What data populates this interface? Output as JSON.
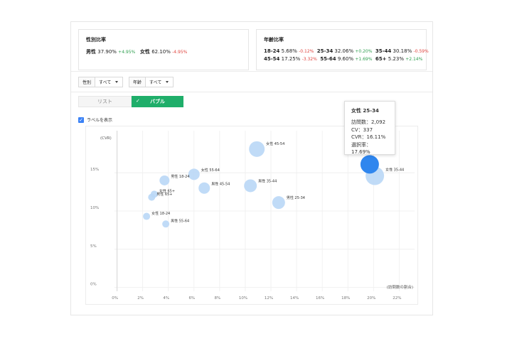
{
  "gender": {
    "title": "性別比率",
    "male_label": "男性",
    "male_value": "37.90%",
    "male_delta": "+4.95%",
    "female_label": "女性",
    "female_value": "62.10%",
    "female_delta": "-4.95%"
  },
  "age": {
    "title": "年齢比率",
    "items": [
      {
        "label": "18-24",
        "value": "5.68%",
        "delta": "-0.12%",
        "dir": "neg"
      },
      {
        "label": "25-34",
        "value": "32.06%",
        "delta": "+0.20%",
        "dir": "pos"
      },
      {
        "label": "35-44",
        "value": "30.18%",
        "delta": "-0.59%",
        "dir": "neg"
      },
      {
        "label": "45-54",
        "value": "17.25%",
        "delta": "-3.32%",
        "dir": "neg"
      },
      {
        "label": "55-64",
        "value": "9.60%",
        "delta": "+1.69%",
        "dir": "pos"
      },
      {
        "label": "65+",
        "value": "5.23%",
        "delta": "+2.14%",
        "dir": "pos"
      }
    ]
  },
  "filters": {
    "gender_label": "性別",
    "gender_value": "すべて",
    "age_label": "年齢",
    "age_value": "すべて"
  },
  "view_toggle": {
    "list_label": "リスト",
    "bubble_label": "バブル",
    "check_glyph": "✓"
  },
  "show_labels": {
    "label": "ラベルを表示",
    "checked": true
  },
  "tooltip": {
    "title": "女性 25-34",
    "visits": "訪問数：2,092",
    "cv": "CV：337",
    "cvr": "CVR：16.11%",
    "share": "選択率：17.69%"
  },
  "chart_data": {
    "type": "scatter",
    "title": "",
    "xlabel": "(訪問数の割合)",
    "ylabel": "(CVR)",
    "x_ticks": [
      "0%",
      "2%",
      "4%",
      "6%",
      "8%",
      "10%",
      "12%",
      "14%",
      "16%",
      "18%",
      "20%",
      "22%"
    ],
    "y_ticks": [
      "0%",
      "5%",
      "10%",
      "15%"
    ],
    "xlim": [
      -0.2,
      23.2
    ],
    "ylim": [
      -0.5,
      20.5
    ],
    "colors": {
      "bubble": "#b9d7f6",
      "highlight": "#2f86ee",
      "grid": "#eeeeee"
    },
    "points": [
      {
        "label": "女性 45-54",
        "x": 10.9,
        "y": 18.1,
        "size": 11
      },
      {
        "label": "女性 25-34",
        "x": 19.7,
        "y": 16.1,
        "size": 13,
        "highlight": true
      },
      {
        "label": "女性 35-44",
        "x": 20.1,
        "y": 14.6,
        "size": 13
      },
      {
        "label": "女性 55-64",
        "x": 6.0,
        "y": 14.8,
        "size": 8
      },
      {
        "label": "男性 18-24",
        "x": 3.7,
        "y": 14.0,
        "size": 7
      },
      {
        "label": "男性 45-54",
        "x": 6.8,
        "y": 13.0,
        "size": 8
      },
      {
        "label": "男性 35-44",
        "x": 10.4,
        "y": 13.3,
        "size": 9
      },
      {
        "label": "男性 25-34",
        "x": 12.6,
        "y": 11.1,
        "size": 9
      },
      {
        "label": "女性 65+",
        "x": 2.9,
        "y": 12.2,
        "size": 5
      },
      {
        "label": "男性 65+",
        "x": 2.7,
        "y": 11.8,
        "size": 5
      },
      {
        "label": "女性 18-24",
        "x": 2.3,
        "y": 9.3,
        "size": 5
      },
      {
        "label": "男性 55-64",
        "x": 3.8,
        "y": 8.3,
        "size": 5
      }
    ]
  }
}
